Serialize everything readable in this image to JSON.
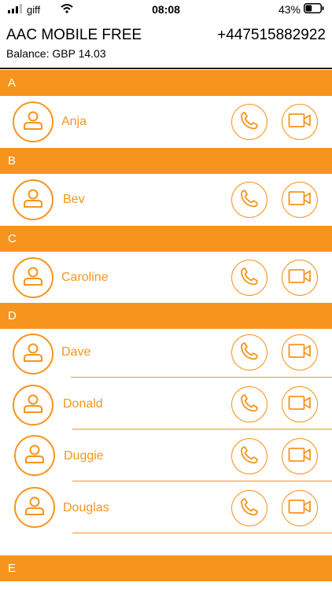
{
  "status_bar": {
    "carrier": "giff",
    "time": "08:08",
    "battery": "43%",
    "battery_level": 0.43,
    "icons": [
      "signal-icon",
      "wifi-icon",
      "battery-icon"
    ]
  },
  "header": {
    "title": "AAC MOBILE FREE",
    "phone": "+447515882922",
    "balance": "Balance: GBP 14.03"
  },
  "sections": [
    {
      "letter": "A",
      "contacts": [
        {
          "name": "Anja"
        }
      ]
    },
    {
      "letter": "B",
      "contacts": [
        {
          "name": "Bev"
        }
      ]
    },
    {
      "letter": "C",
      "contacts": [
        {
          "name": "Caroline"
        }
      ]
    },
    {
      "letter": "D",
      "contacts": [
        {
          "name": "Dave"
        },
        {
          "name": "Donald"
        },
        {
          "name": "Duggie"
        },
        {
          "name": "Douglas"
        }
      ]
    },
    {
      "letter": "E",
      "contacts": []
    }
  ],
  "colors": {
    "accent": "#f7941d",
    "header_text": "#ffffff",
    "background": "#ffffff"
  }
}
